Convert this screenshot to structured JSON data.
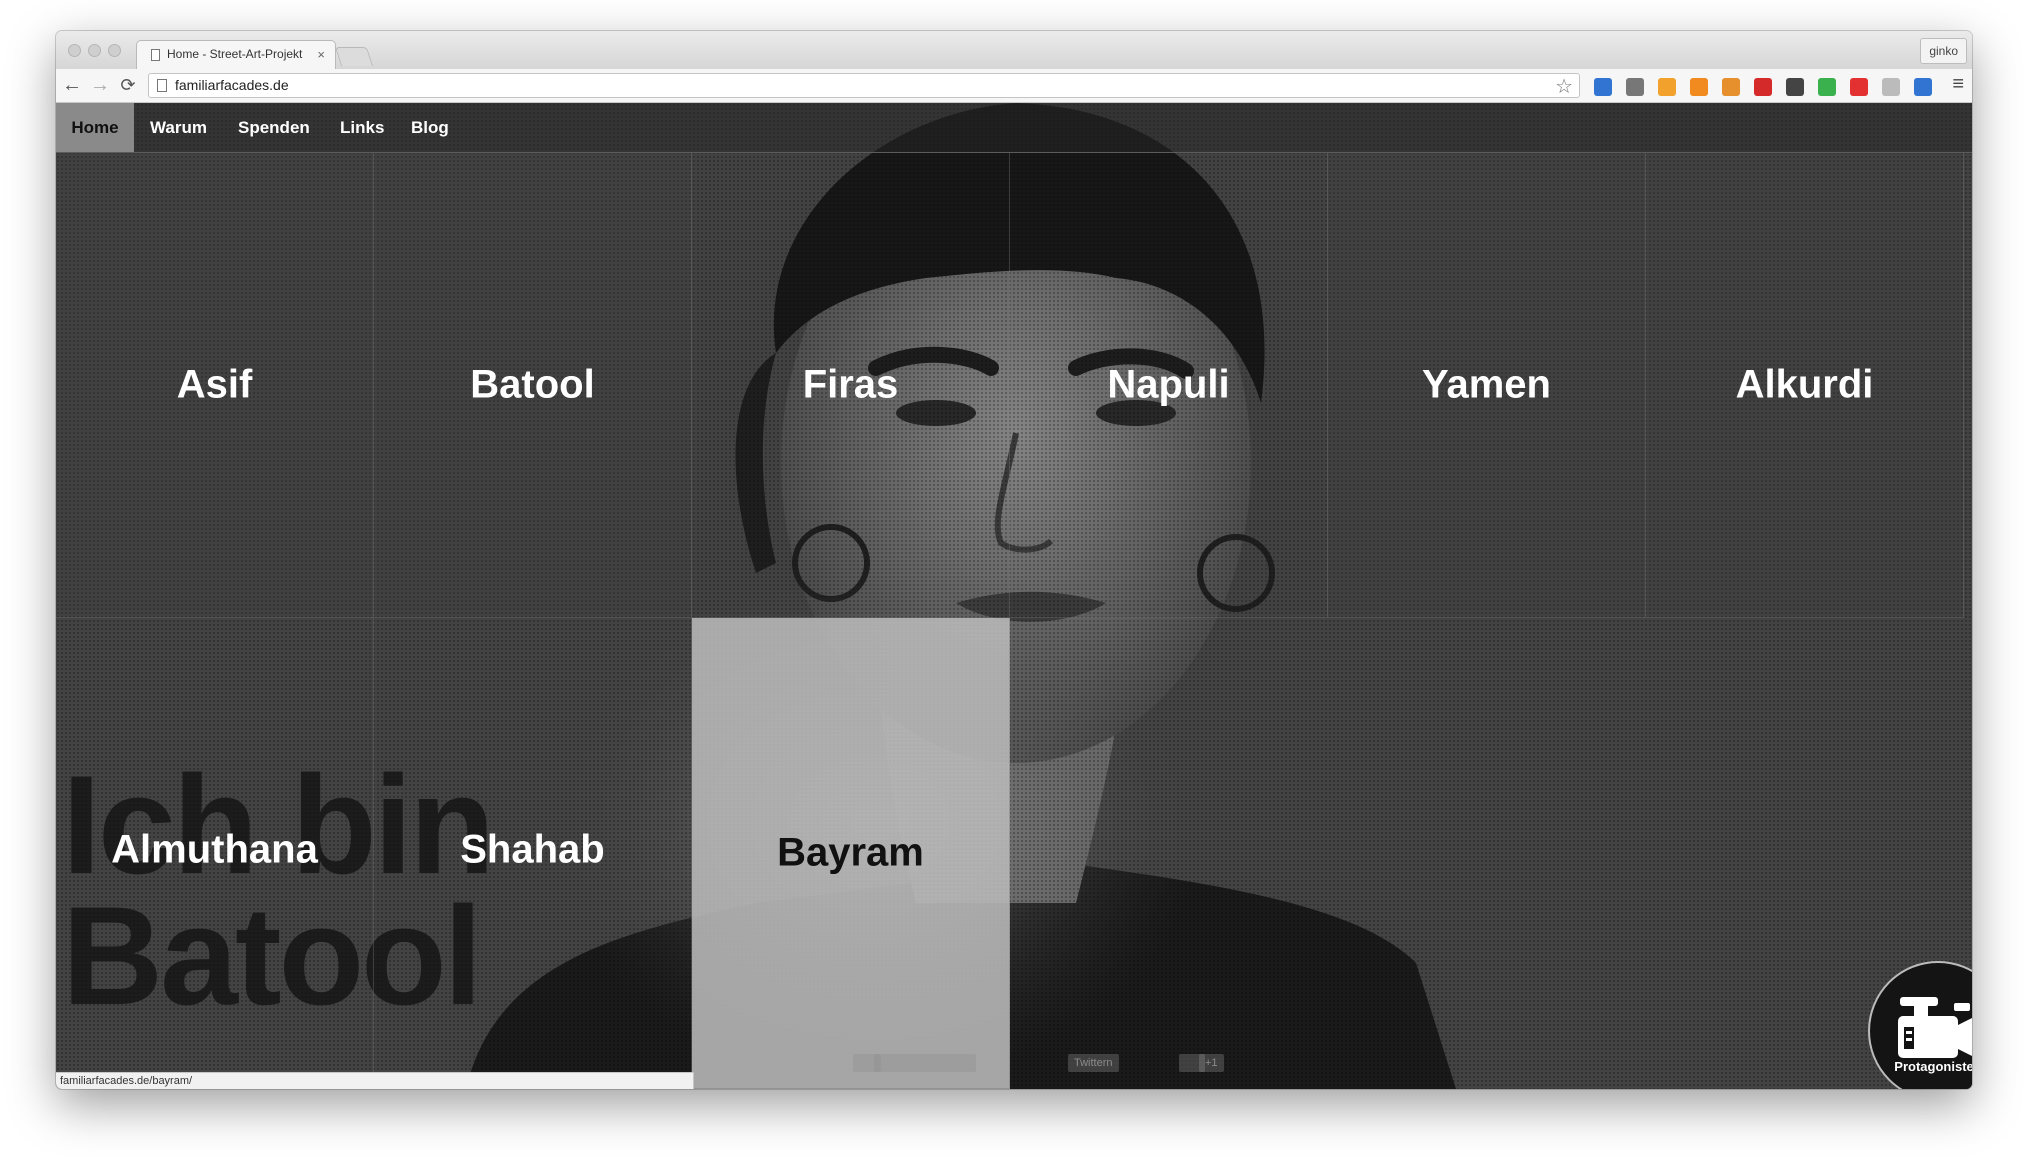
{
  "browser": {
    "tab_title": "Home - Street-Art-Projekt",
    "tab_close": "×",
    "profile_name": "ginko",
    "url": "familiarfacades.de",
    "back_glyph": "←",
    "forward_glyph": "→",
    "reload_glyph": "⟳",
    "star_glyph": "☆",
    "menu_glyph": "≡",
    "status_url": "familiarfacades.de/bayram/",
    "extensions": [
      {
        "name": "delicious-icon",
        "color": "#3274d1"
      },
      {
        "name": "eyedropper-icon",
        "color": "#777777"
      },
      {
        "name": "feed-icon",
        "color": "#f2a12c"
      },
      {
        "name": "chart-icon",
        "color": "#f28b1f"
      },
      {
        "name": "wallet-icon",
        "color": "#e58f2d"
      },
      {
        "name": "calendar-icon",
        "color": "#d42a2a"
      },
      {
        "name": "star-icon",
        "color": "#444444"
      },
      {
        "name": "colors-icon",
        "color": "#3ab14d"
      },
      {
        "name": "adblock-icon",
        "color": "#e33030"
      },
      {
        "name": "tag-icon",
        "color": "#bbbbbb"
      },
      {
        "name": "delicious-2-icon",
        "color": "#3274d1"
      }
    ]
  },
  "site": {
    "nav": [
      {
        "label": "Home",
        "active": true
      },
      {
        "label": "Warum",
        "active": false
      },
      {
        "label": "Spenden",
        "active": false
      },
      {
        "label": "Links",
        "active": false
      },
      {
        "label": "Blog",
        "active": false
      }
    ],
    "hero_line1": "Ich bin",
    "hero_line2": "Batool",
    "protagonists": [
      "Asif",
      "Batool",
      "Firas",
      "Napuli",
      "Yamen",
      "Alkurdi",
      "Almuthana",
      "Shahab",
      "Bayram"
    ],
    "selected": "Bayram",
    "protagonists_badge": "Protagonisten",
    "share_twitter": "Twittern",
    "share_plus": "+1",
    "colors": {
      "page_bg": "#444444",
      "selected_tile": "#b9b9b9",
      "nav_active": "#8a8a8a"
    }
  }
}
